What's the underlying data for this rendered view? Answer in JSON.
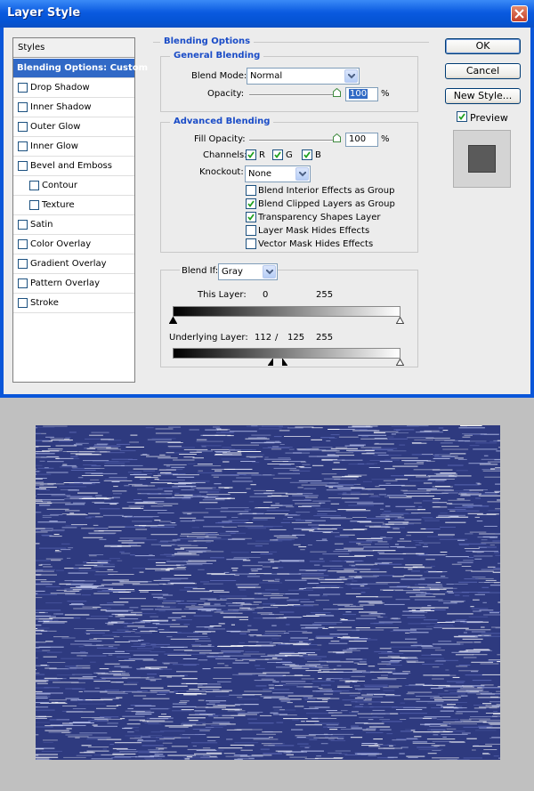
{
  "window": {
    "title": "Layer Style"
  },
  "styles_list": {
    "header": "Styles",
    "selected": "Blending Options: Custom",
    "items": [
      {
        "label": "Drop Shadow",
        "checked": false
      },
      {
        "label": "Inner Shadow",
        "checked": false
      },
      {
        "label": "Outer Glow",
        "checked": false
      },
      {
        "label": "Inner Glow",
        "checked": false
      },
      {
        "label": "Bevel and Emboss",
        "checked": false
      },
      {
        "label": "Contour",
        "checked": false
      },
      {
        "label": "Texture",
        "checked": false
      },
      {
        "label": "Satin",
        "checked": false
      },
      {
        "label": "Color Overlay",
        "checked": false
      },
      {
        "label": "Gradient Overlay",
        "checked": false
      },
      {
        "label": "Pattern Overlay",
        "checked": false
      },
      {
        "label": "Stroke",
        "checked": false
      }
    ]
  },
  "blending_options": {
    "title": "Blending Options",
    "general": {
      "title": "General Blending",
      "blend_mode_label": "Blend Mode:",
      "blend_mode": "Normal",
      "opacity_label": "Opacity:",
      "opacity": "100",
      "unit": "%"
    },
    "advanced": {
      "title": "Advanced Blending",
      "fill_opacity_label": "Fill Opacity:",
      "fill_opacity": "100",
      "unit": "%",
      "channels_label": "Channels:",
      "channels": [
        {
          "label": "R",
          "checked": true
        },
        {
          "label": "G",
          "checked": true
        },
        {
          "label": "B",
          "checked": true
        }
      ],
      "knockout_label": "Knockout:",
      "knockout": "None",
      "options": [
        {
          "label": "Blend Interior Effects as Group",
          "checked": false
        },
        {
          "label": "Blend Clipped Layers as Group",
          "checked": true
        },
        {
          "label": "Transparency Shapes Layer",
          "checked": true
        },
        {
          "label": "Layer Mask Hides Effects",
          "checked": false
        },
        {
          "label": "Vector Mask Hides Effects",
          "checked": false
        }
      ]
    },
    "blend_if": {
      "label": "Blend If:",
      "value": "Gray",
      "this_layer_label": "This Layer:",
      "this_layer_low": "0",
      "this_layer_high": "255",
      "underlying_label": "Underlying Layer:",
      "underlying_low": "112",
      "underlying_sep": "/",
      "underlying_mid": "125",
      "underlying_high": "255"
    }
  },
  "buttons": {
    "ok": "OK",
    "cancel": "Cancel",
    "new_style": "New Style..."
  },
  "preview": {
    "label": "Preview",
    "checked": true
  },
  "colors": {
    "titlebar": "#0a56d9",
    "selection": "#3169c6",
    "legend": "#1a4cc7",
    "texture_base": "#2e3a7f"
  }
}
